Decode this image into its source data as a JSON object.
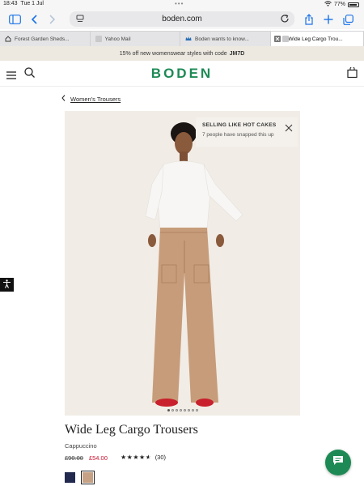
{
  "status": {
    "time": "18:43",
    "date": "Tue 1 Jul",
    "battery": "77%"
  },
  "browser": {
    "url": "boden.com"
  },
  "tabs": [
    {
      "label": "Forest Garden Sheds..."
    },
    {
      "label": "Yahoo Mail"
    },
    {
      "label": "Boden wants to know..."
    },
    {
      "label": "Wide Leg Cargo Trou..."
    }
  ],
  "promo": {
    "text": "15% off new womenswear styles with code",
    "code": "JM7D"
  },
  "site": {
    "logo": "BODEN"
  },
  "breadcrumb": {
    "label": "Women's Trousers"
  },
  "toast": {
    "title": "SELLING LIKE HOT CAKES",
    "message": "7 people have snapped this up"
  },
  "gallery": {
    "image_count": 8,
    "current_index": 0
  },
  "product": {
    "title": "Wide Leg Cargo Trousers",
    "color": "Cappuccino",
    "old_price": "£90.00",
    "sale_price": "£54.00",
    "rating": 4.5,
    "review_count": "(30)",
    "swatches": [
      {
        "name": "navy",
        "hex": "#222a4f"
      },
      {
        "name": "cappuccino",
        "hex": "#c6a184",
        "selected": true
      }
    ]
  },
  "colors": {
    "brand": "#1d8a55",
    "sale": "#c8102e",
    "accent": "#1a73e8"
  }
}
